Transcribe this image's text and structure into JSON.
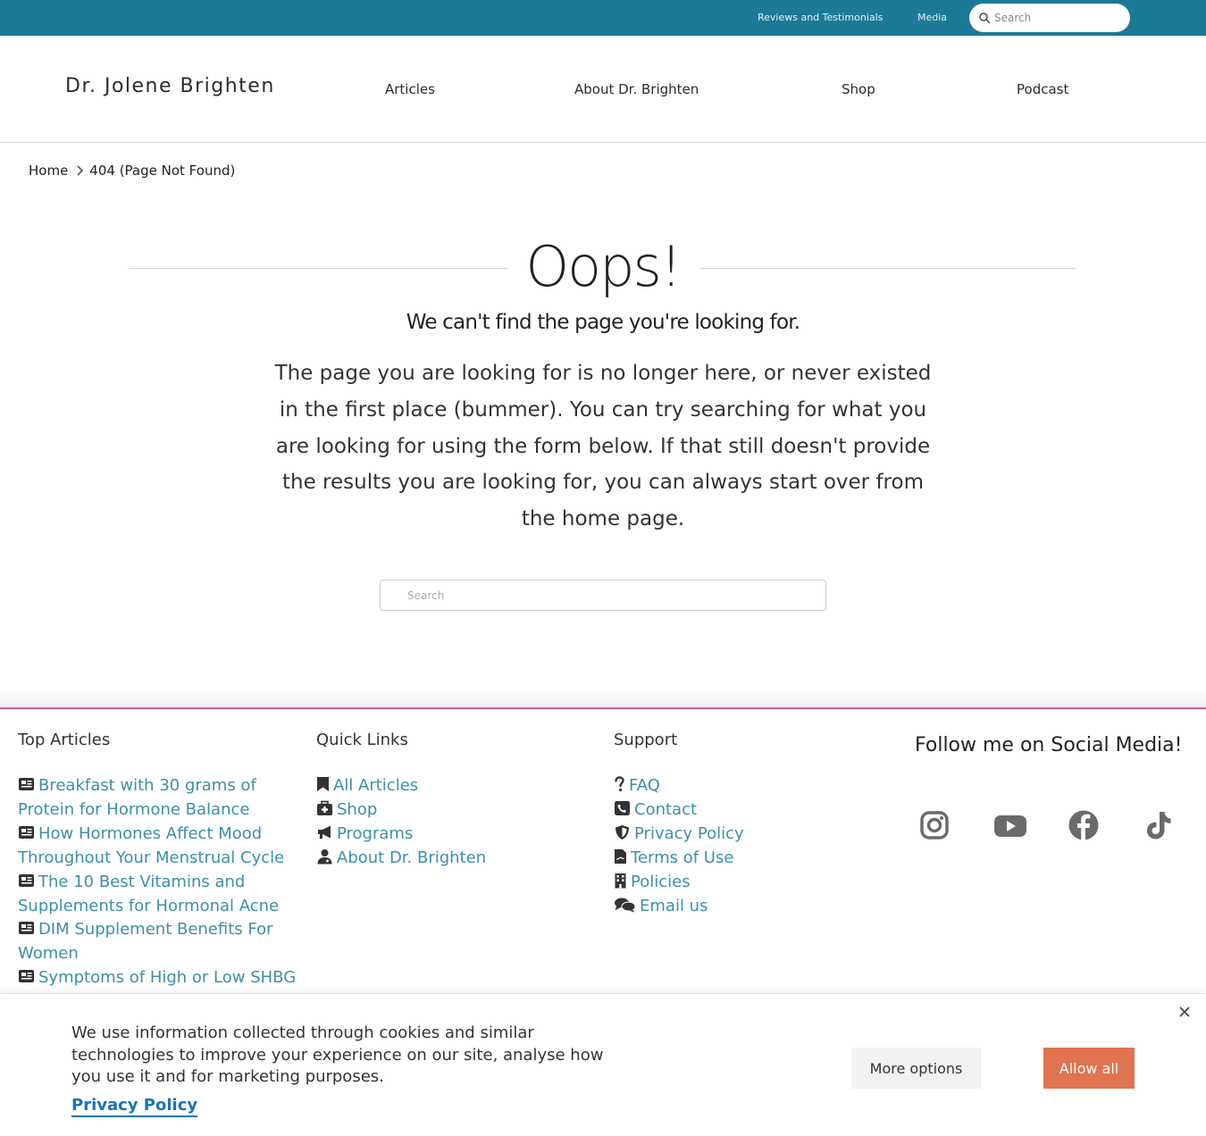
{
  "topbar": {
    "links": [
      "Reviews and Testimonials",
      "Media"
    ],
    "search_placeholder": "Search"
  },
  "header": {
    "logo": "Dr. Jolene Brighten",
    "nav": [
      "Articles",
      "About Dr. Brighten",
      "Shop",
      "Podcast"
    ]
  },
  "breadcrumb": {
    "home": "Home",
    "current": "404 (Page Not Found)"
  },
  "error": {
    "title": "Oops!",
    "subtitle": "We can't find the page you're looking for.",
    "body": "The page you are looking for is no longer here, or never existed in the first place (bummer). You can try searching for what you are looking for using the form below. If that still doesn't provide the results you are looking for, you can always start over from the home page.",
    "search_placeholder": "Search"
  },
  "footer": {
    "top_articles": {
      "title": "Top Articles",
      "items": [
        "Breakfast with 30 grams of Protein for Hormone Balance",
        "How Hormones Affect Mood Throughout Your Menstrual Cycle",
        "The 10 Best Vitamins and Supplements for Hormonal Acne",
        "DIM Supplement Benefits For Women",
        "Symptoms of High or Low SHBG"
      ]
    },
    "quick_links": {
      "title": "Quick Links",
      "items": [
        {
          "label": "All Articles",
          "icon": "bookmark-icon"
        },
        {
          "label": "Shop",
          "icon": "medkit-icon"
        },
        {
          "label": "Programs",
          "icon": "bullhorn-icon"
        },
        {
          "label": "About Dr. Brighten",
          "icon": "doctor-icon"
        }
      ]
    },
    "support": {
      "title": "Support",
      "items": [
        {
          "label": "FAQ",
          "icon": "question-icon"
        },
        {
          "label": "Contact",
          "icon": "phone-icon"
        },
        {
          "label": "Privacy Policy",
          "icon": "shield-icon"
        },
        {
          "label": "Terms of Use",
          "icon": "file-signature-icon"
        },
        {
          "label": "Policies",
          "icon": "building-icon"
        },
        {
          "label": "Email us",
          "icon": "comments-icon"
        }
      ]
    },
    "social": {
      "title": "Follow me on Social Media!",
      "icons": [
        "instagram-icon",
        "youtube-icon",
        "facebook-icon",
        "tiktok-icon"
      ]
    }
  },
  "cookie": {
    "text": "We use information collected through cookies and similar technologies to improve your experience on our site, analyse how you use it and for marketing purposes.",
    "policy_link": "Privacy Policy",
    "more_label": "More options",
    "allow_label": "Allow all"
  },
  "colors": {
    "topbar": "#1c7a96",
    "link": "#3d8fa8",
    "footer_accent": "#e0569f",
    "allow_button": "#e07350",
    "policy_link": "#1a73b7"
  }
}
